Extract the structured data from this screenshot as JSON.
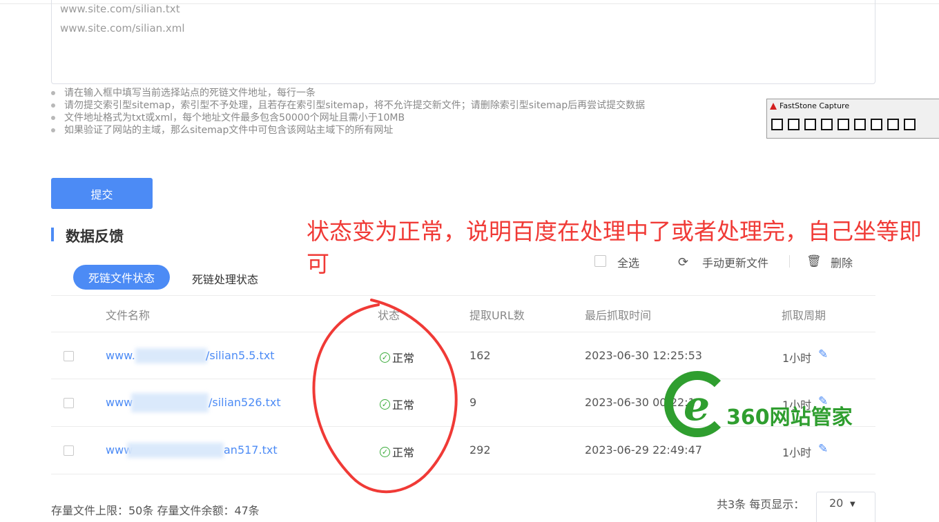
{
  "textarea": {
    "lines": [
      "www.site.com/silian.txt",
      "www.site.com/silian.xml"
    ]
  },
  "tips": [
    "请在输入框中填写当前选择站点的死链文件地址，每行一条",
    "请勿提交索引型sitemap，索引型不予处理，且若存在索引型sitemap，将不允许提交新文件；请删除索引型sitemap后再尝试提交数据",
    "文件地址格式为txt或xml，每个地址文件最多包含50000个网址且需小于10MB",
    "如果验证了网站的主域，那么sitemap文件中可包含该网站主域下的所有网址"
  ],
  "faststone": {
    "title": "FastStone Capture"
  },
  "submit_label": "提交",
  "section_title": "数据反馈",
  "annotation": "状态变为正常，说明百度在处理中了或者处理完，自己坐等即可",
  "tabs": {
    "file_status": "死链文件状态",
    "process_status": "死链处理状态"
  },
  "actions": {
    "select_all": "全选",
    "refresh": "手动更新文件",
    "delete": "删除"
  },
  "columns": {
    "file_name": "文件名称",
    "status": "状态",
    "url_count": "提取URL数",
    "last_fetch": "最后抓取时间",
    "period": "抓取周期"
  },
  "rows": [
    {
      "prefix": "www.",
      "suffix": "/silian5.5.txt",
      "status": "正常",
      "url_count": "162",
      "last_fetch": "2023-06-30 12:25:53",
      "period": "1小时"
    },
    {
      "prefix": "www",
      "suffix": "/silian526.txt",
      "status": "正常",
      "url_count": "9",
      "last_fetch": "2023-06-30 00:22:1",
      "period": "1小时"
    },
    {
      "prefix": "www",
      "suffix": "an517.txt",
      "status": "正常",
      "url_count": "292",
      "last_fetch": "2023-06-29 22:49:47",
      "period": "1小时"
    }
  ],
  "watermark": {
    "text": "360网站管家",
    "glyph": "e"
  },
  "footer": {
    "quota": "存量文件上限：50条  存量文件余额：47条",
    "total": "共3条  每页显示：",
    "page_size": "20"
  },
  "colors": {
    "primary": "#4c8bf5",
    "annotation": "#f03a36",
    "ok": "#3aab3a",
    "watermark": "#2f9e2f"
  }
}
